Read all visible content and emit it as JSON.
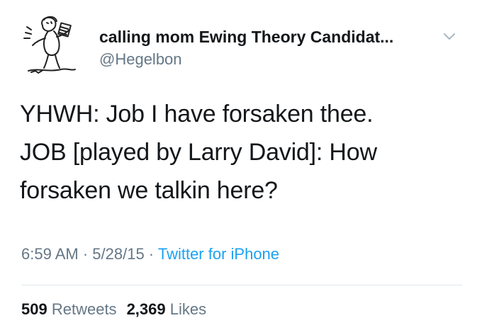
{
  "user": {
    "display_name": "calling mom Ewing Theory Candidat...",
    "handle": "@Hegelbon",
    "avatar_icon": "cartoon-character-avatar-icon"
  },
  "tweet": {
    "lines": [
      "YHWH: Job I have forsaken thee.",
      "JOB [played by Larry David]: How",
      "forsaken we talkin here?"
    ]
  },
  "meta": {
    "time": "6:59 AM",
    "separator": " · ",
    "date": "5/28/15",
    "source": "Twitter for iPhone"
  },
  "stats": {
    "retweets_count": "509",
    "retweets_label": "Retweets",
    "likes_count": "2,369",
    "likes_label": "Likes"
  },
  "colors": {
    "text": "#14171a",
    "secondary": "#657786",
    "link": "#1da1f2",
    "divider": "#e1e8ed"
  }
}
